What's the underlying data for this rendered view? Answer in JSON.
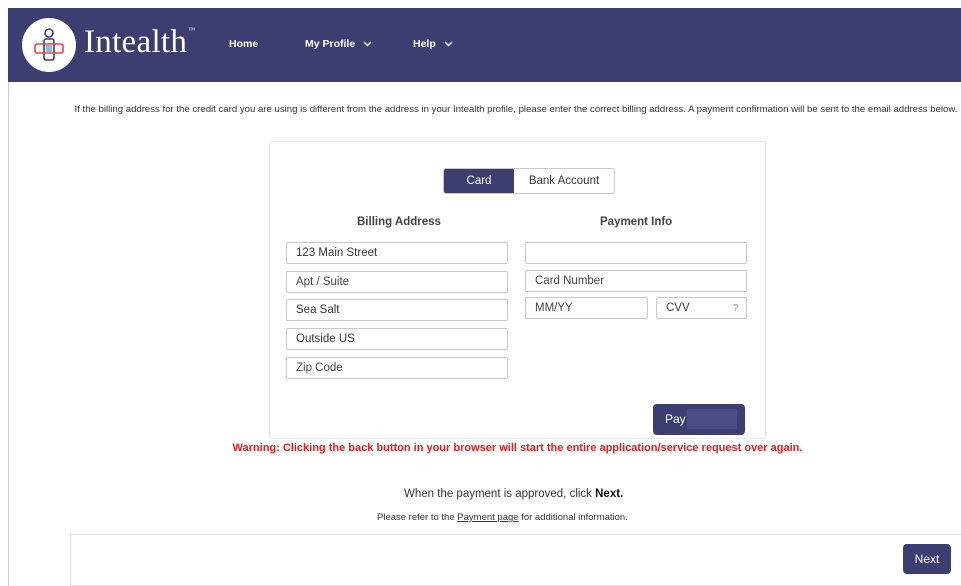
{
  "header": {
    "brand": "Intealth",
    "trademark": "™",
    "nav": {
      "home": "Home",
      "my_profile": "My Profile",
      "help": "Help"
    }
  },
  "intro_text": "If the billing address for the credit card you are using is different from the address in your Intealth profile, please enter the correct billing address. A payment confirmation will be sent to the email address below.",
  "tabs": {
    "card": "Card",
    "bank_account": "Bank Account"
  },
  "billing": {
    "title": "Billing Address",
    "street": "123 Main Street",
    "apt_placeholder": "Apt / Suite",
    "city": "Sea Salt",
    "state": "Outside US",
    "zip_placeholder": "Zip Code"
  },
  "payment": {
    "title": "Payment Info",
    "name_value": "",
    "card_number_placeholder": "Card Number",
    "expiry_placeholder": "MM/YY",
    "cvv_placeholder": "CVV",
    "cvv_help": "?",
    "pay_label": "Pay"
  },
  "warning": "Warning: Clicking the back button in your browser will start the entire application/service request over again.",
  "approved_prefix": "When the payment is approved, click ",
  "approved_strong": "Next.",
  "refer_prefix": "Please refer to the ",
  "refer_link": "Payment page",
  "refer_suffix": " for additional information.",
  "next_label": "Next",
  "colors": {
    "brand": "#3c3d71",
    "warning": "#e02020"
  }
}
